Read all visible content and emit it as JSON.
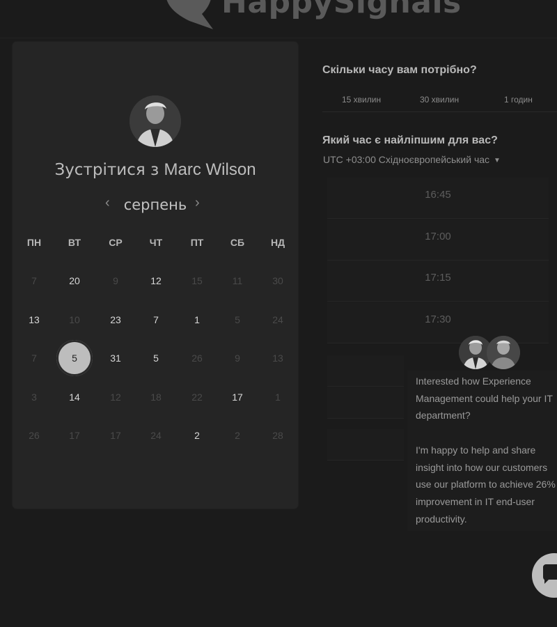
{
  "brand": {
    "name": "HappySignals"
  },
  "calendar": {
    "title_prefix": "Зустрітися з",
    "host_name": "Marc Wilson",
    "month": "серпень",
    "prev_icon": "‹",
    "next_icon": "›",
    "weekdays": [
      "ПН",
      "ВТ",
      "СР",
      "ЧТ",
      "ПТ",
      "СБ",
      "НД"
    ],
    "weeks": [
      [
        {
          "d": "7",
          "s": "dim"
        },
        {
          "d": "20",
          "s": "avail"
        },
        {
          "d": "9",
          "s": "dim"
        },
        {
          "d": "12",
          "s": "avail"
        },
        {
          "d": "15",
          "s": "dim"
        },
        {
          "d": "11",
          "s": "dim"
        },
        {
          "d": "30",
          "s": "dim"
        }
      ],
      [
        {
          "d": "13",
          "s": "avail"
        },
        {
          "d": "10",
          "s": "dim"
        },
        {
          "d": "23",
          "s": "avail"
        },
        {
          "d": "7",
          "s": "avail"
        },
        {
          "d": "1",
          "s": "avail"
        },
        {
          "d": "5",
          "s": "dim"
        },
        {
          "d": "24",
          "s": "dim"
        }
      ],
      [
        {
          "d": "7",
          "s": "dim"
        },
        {
          "d": "5",
          "s": "selected"
        },
        {
          "d": "31",
          "s": "avail"
        },
        {
          "d": "5",
          "s": "avail"
        },
        {
          "d": "26",
          "s": "dim"
        },
        {
          "d": "9",
          "s": "dim"
        },
        {
          "d": "13",
          "s": "dim"
        }
      ],
      [
        {
          "d": "3",
          "s": "dim"
        },
        {
          "d": "14",
          "s": "avail"
        },
        {
          "d": "12",
          "s": "dim"
        },
        {
          "d": "18",
          "s": "dim"
        },
        {
          "d": "22",
          "s": "dim"
        },
        {
          "d": "17",
          "s": "avail"
        },
        {
          "d": "1",
          "s": "dim"
        }
      ],
      [
        {
          "d": "26",
          "s": "dim"
        },
        {
          "d": "17",
          "s": "dim"
        },
        {
          "d": "17",
          "s": "dim"
        },
        {
          "d": "24",
          "s": "dim"
        },
        {
          "d": "2",
          "s": "avail"
        },
        {
          "d": "2",
          "s": "dim"
        },
        {
          "d": "28",
          "s": "dim"
        }
      ]
    ]
  },
  "duration": {
    "title": "Скільки часу вам потрібно?",
    "options": [
      "15 хвилин",
      "30 хвилин",
      "1 годин"
    ]
  },
  "timeslots": {
    "title": "Який час є найліпшим для вас?",
    "timezone": "UTC +03:00 Східноєвропейський час",
    "times": [
      "16:45",
      "17:00",
      "17:15",
      "17:30"
    ]
  },
  "chat": {
    "message_1": "Interested how Experience Management could help your IT department?",
    "message_2": "I'm happy to help and share insight into how our customers use our platform to achieve 26% improvement in IT end-user productivity."
  },
  "colors": {
    "background": "#1b1b1b",
    "panel": "#252525",
    "selected_day": "#bdbdbd"
  }
}
